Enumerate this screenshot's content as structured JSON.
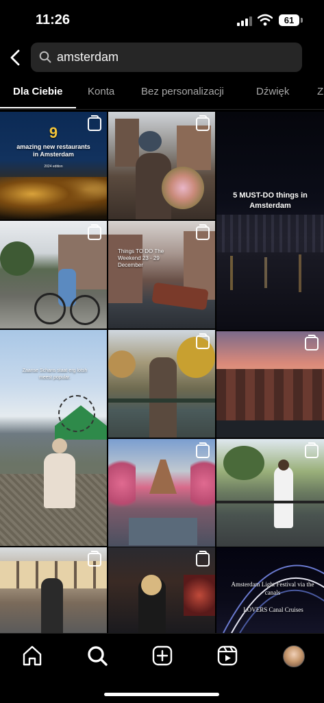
{
  "status_bar": {
    "time": "11:26",
    "battery": "61"
  },
  "search": {
    "query": "amsterdam",
    "back_icon": "chevron-left-icon",
    "search_icon": "search-icon"
  },
  "tabs": [
    {
      "label": "Dla Ciebie",
      "active": true
    },
    {
      "label": "Konta",
      "active": false
    },
    {
      "label": "Bez personalizacji",
      "active": false
    },
    {
      "label": "Dźwięk",
      "active": false
    },
    {
      "label": "Z",
      "active": false
    }
  ],
  "tiles": [
    {
      "id": "t1",
      "big": "9",
      "line1": "amazing new restaurants",
      "line2": "in Amsterdam",
      "line3": "2024 edition"
    },
    {
      "id": "t2"
    },
    {
      "id": "t3",
      "caption": "5 MUST-DO things in Amsterdam"
    },
    {
      "id": "t4"
    },
    {
      "id": "t5",
      "caption": "Things TO DO The Weekend 23 - 29 December"
    },
    {
      "id": "t6"
    },
    {
      "id": "t7",
      "caption": "Zaanse Schans staat erg lotsh meest popular."
    },
    {
      "id": "t8"
    },
    {
      "id": "t9"
    },
    {
      "id": "t10"
    },
    {
      "id": "t11"
    },
    {
      "id": "t12"
    },
    {
      "id": "t13"
    },
    {
      "id": "t14",
      "caption1": "Amsterdam Light Festival via the canals",
      "caption2": "LOVERS Canal Cruises"
    }
  ],
  "bottom_nav": [
    {
      "name": "home",
      "icon": "home-icon"
    },
    {
      "name": "search",
      "icon": "search-icon"
    },
    {
      "name": "create",
      "icon": "plus-square-icon"
    },
    {
      "name": "reels",
      "icon": "reels-icon"
    },
    {
      "name": "profile",
      "icon": "avatar"
    }
  ]
}
